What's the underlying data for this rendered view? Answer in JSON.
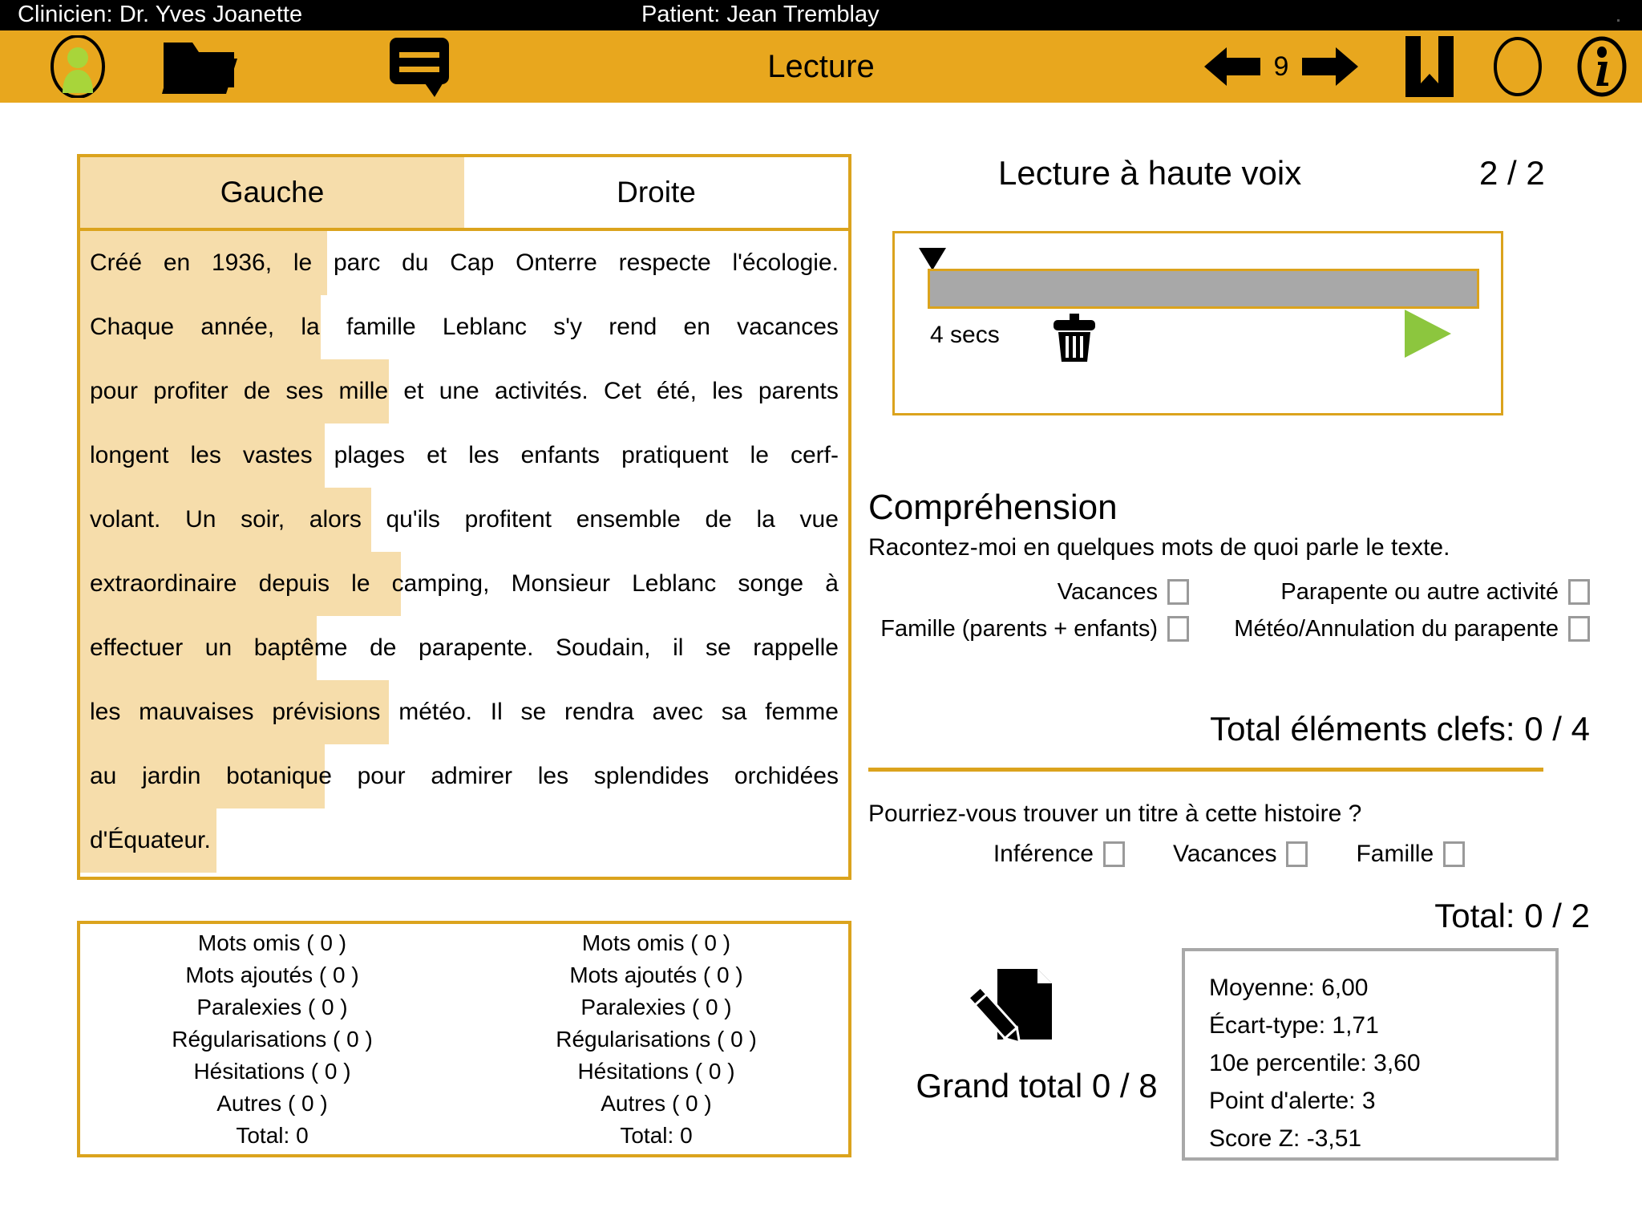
{
  "statusbar": {
    "clinician": "Clinicien: Dr. Yves Joanette",
    "patient": "Patient: Jean Tremblay"
  },
  "toolbar": {
    "title": "Lecture",
    "page_number": "9",
    "icons": {
      "profile": "user-avatar-icon",
      "folder": "open-folder-icon",
      "notes": "speech-bubble-icon",
      "prev": "arrow-left-icon",
      "next": "arrow-right-icon",
      "bookmark": "bookmark-icon",
      "record": "record-circle-icon",
      "info": "info-icon"
    }
  },
  "text_panel": {
    "tabs": [
      {
        "label": "Gauche",
        "active": true
      },
      {
        "label": "Droite",
        "active": false
      }
    ],
    "lines": [
      {
        "text": "Créé en 1936, le parc du Cap Onterre respecte l'écologie.",
        "highlight_width": 308
      },
      {
        "text": "Chaque année, la famille Leblanc s'y rend en vacances",
        "highlight_width": 300
      },
      {
        "text": "pour profiter de ses mille et une activités. Cet été, les parents",
        "highlight_width": 385
      },
      {
        "text": "longent les vastes plages et les enfants pratiquent le cerf-",
        "highlight_width": 305
      },
      {
        "text": "volant. Un soir, alors qu'ils profitent ensemble de la vue",
        "highlight_width": 363
      },
      {
        "text": "extraordinaire depuis le camping, Monsieur Leblanc songe à",
        "highlight_width": 400
      },
      {
        "text": "effectuer un baptême de parapente. Soudain, il se rappelle",
        "highlight_width": 295
      },
      {
        "text": "les mauvaises prévisions météo. Il se rendra avec sa femme",
        "highlight_width": 385
      },
      {
        "text": "au jardin botanique pour admirer les splendides orchidées",
        "highlight_width": 305
      },
      {
        "text": "d'Équateur.",
        "highlight_width": 170
      }
    ]
  },
  "counts_panel": {
    "columns": [
      {
        "rows": [
          "Mots omis ( 0 )",
          "Mots ajoutés ( 0 )",
          "Paralexies ( 0 )",
          "Régularisations ( 0 )",
          "Hésitations ( 0 )",
          "Autres ( 0 )",
          "Total: 0"
        ]
      },
      {
        "rows": [
          "Mots omis ( 0 )",
          "Mots ajoutés ( 0 )",
          "Paralexies ( 0 )",
          "Régularisations ( 0 )",
          "Hésitations ( 0 )",
          "Autres ( 0 )",
          "Total: 0"
        ]
      }
    ]
  },
  "reading_aloud": {
    "title": "Lecture à haute voix",
    "counter": "2 / 2",
    "duration": "4 secs",
    "delete_icon": "trash-icon",
    "play_icon": "play-icon"
  },
  "comprehension": {
    "title": "Compréhension",
    "prompt": "Racontez-moi en quelques mots de quoi parle le texte.",
    "items": [
      {
        "label": "Vacances",
        "checked": false
      },
      {
        "label": "Parapente ou autre activité",
        "checked": false
      },
      {
        "label": "Famille (parents + enfants)",
        "checked": false
      },
      {
        "label": "Météo/Annulation du parapente",
        "checked": false
      }
    ],
    "key_total": "Total éléments clefs: 0 / 4",
    "title_question": "Pourriez-vous trouver un titre à cette histoire ?",
    "title_items": [
      {
        "label": "Inférence",
        "checked": false
      },
      {
        "label": "Vacances",
        "checked": false
      },
      {
        "label": "Famille",
        "checked": false
      }
    ],
    "title_total": "Total: 0 / 2"
  },
  "summary": {
    "notes_icon": "note-pencil-icon",
    "grand_total": "Grand total  0 / 8",
    "stats": [
      "Moyenne: 6,00",
      "Écart-type: 1,71",
      "10e percentile: 3,60",
      "Point d'alerte: 3",
      "Score Z: -3,51"
    ]
  },
  "colors": {
    "toolbar": "#e8a71e",
    "border": "#dba31d",
    "highlight": "#f6ddab",
    "play_green": "#8CC63E",
    "avatar_green": "#A8D53A",
    "wave": "#a8a8a8"
  }
}
